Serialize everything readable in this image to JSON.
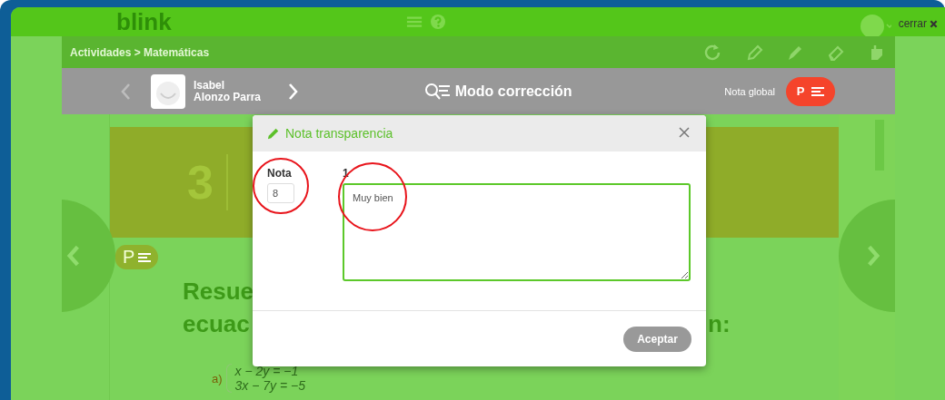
{
  "top_bar": {
    "logo": "blink",
    "close_label": "cerrar"
  },
  "activity_bar": {
    "breadcrumb": "Actividades > Matemáticas"
  },
  "student_bar": {
    "first_name": "Isabel",
    "last_name": "Alonzo Parra",
    "mode_title": "Modo corrección",
    "global_grade_label": "Nota global",
    "global_grade_badge": "P"
  },
  "page": {
    "unit_number": "3",
    "tag": "P",
    "heading_lines": [
      "Resue",
      "ecuac"
    ],
    "heading_tail": "n:",
    "exercise_label": "a)",
    "equations": [
      "x − 2y = −1",
      "3x − 7y = −5"
    ]
  },
  "dialog": {
    "title": "Nota transparencia",
    "grade_label": "Nota",
    "grade_value": "8",
    "grade_circled": true,
    "comment_label": "1",
    "comment_value": "Muy bien",
    "comment_circled": true,
    "button": "Aceptar"
  }
}
